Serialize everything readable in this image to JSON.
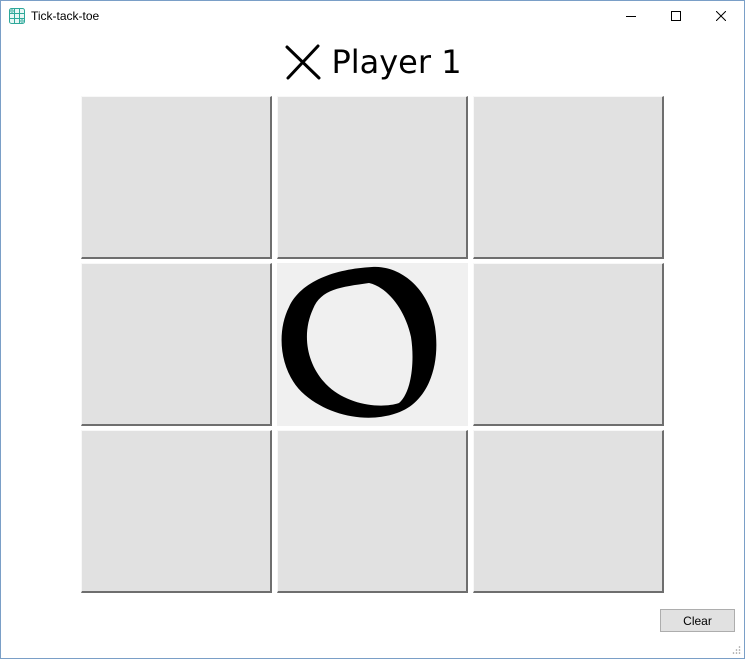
{
  "window": {
    "title": "Tick-tack-toe",
    "icon": "grid-app-icon",
    "controls": [
      "minimize-icon",
      "maximize-icon",
      "close-icon"
    ]
  },
  "header": {
    "turn_symbol": "X",
    "turn_icon": "x-mark-icon",
    "player_label": "Player 1"
  },
  "board": {
    "cells": [
      [
        "",
        "",
        ""
      ],
      [
        "",
        "O",
        ""
      ],
      [
        "",
        "",
        ""
      ]
    ]
  },
  "buttons": {
    "clear_label": "Clear"
  },
  "colors": {
    "cell_empty": "#e1e1e1",
    "cell_played": "#f0f0f0",
    "mark": "#000000",
    "app_icon_accent": "#2ea89a"
  }
}
